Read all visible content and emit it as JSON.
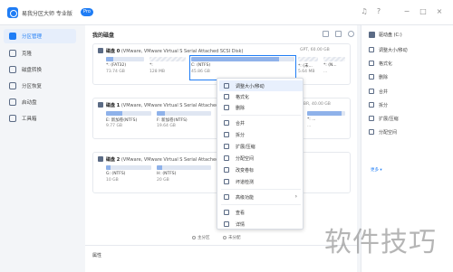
{
  "app": {
    "name": "易我分区大师 专业版",
    "badge": "Pro"
  },
  "titlebar_icons": [
    "bell-icon",
    "help-icon",
    "minimize-icon",
    "maximize-icon",
    "close-icon"
  ],
  "sidebar": {
    "items": [
      {
        "label": "分区管理",
        "icon": "partition-icon",
        "active": true
      },
      {
        "label": "克隆",
        "icon": "clone-icon"
      },
      {
        "label": "磁盘转换",
        "icon": "convert-icon"
      },
      {
        "label": "分区恢复",
        "icon": "recovery-icon"
      },
      {
        "label": "启动盘",
        "icon": "bootdisk-icon"
      },
      {
        "label": "工具箱",
        "icon": "toolbox-icon"
      }
    ]
  },
  "main": {
    "title": "我的磁盘",
    "disks": [
      {
        "name": "磁盘 0",
        "desc": "(VMware, VMware Virtual S Serial Attached SCSI Disk)",
        "extra": "GPT, 60.00 GB",
        "partitions": [
          {
            "name": "*: (FAT32)",
            "size": "73.74 GB",
            "fill": 0.2
          },
          {
            "name": "*:",
            "size": "128 MB",
            "fill": 0,
            "dash": true
          },
          {
            "name": "C: (NTFS)",
            "size": "45.86 GB",
            "fill": 0.85,
            "selected": true
          },
          {
            "name": "*: (未...",
            "size": "5.64 MB",
            "fill": 0,
            "dash": true
          },
          {
            "name": "*: (N...",
            "size": "...",
            "fill": 0.5
          }
        ]
      },
      {
        "name": "磁盘 1",
        "desc": "(VMware, VMware Virtual S Serial Attached SCSI Disk)",
        "extra": "MBR, 40.00 GB",
        "partitions": [
          {
            "name": "E: 新加卷(NTFS)",
            "size": "9.77 GB",
            "fill": 0.35
          },
          {
            "name": "F: 新加卷(NTFS)",
            "size": "19.64 GB",
            "fill": 0.15
          },
          {
            "name": "*: ...",
            "size": "...",
            "fill": 0.9
          }
        ]
      },
      {
        "name": "磁盘 2",
        "desc": "(VMware, VMware Virtual S Serial Attached SCSI Disk)",
        "extra": "",
        "partitions": [
          {
            "name": "G: (NTFS)",
            "size": "10 GB",
            "fill": 0.1
          },
          {
            "name": "H: (NTFS)",
            "size": "20 GB",
            "fill": 0.1
          }
        ]
      }
    ],
    "legend": [
      "主分区",
      "未分配"
    ],
    "properties_label": "属性"
  },
  "context_menu": {
    "items": [
      {
        "label": "调整大小/移动",
        "icon": "resize-icon",
        "highlighted": true
      },
      {
        "label": "格式化",
        "icon": "format-icon"
      },
      {
        "label": "删除",
        "icon": "delete-icon"
      },
      {
        "label": "合并",
        "icon": "merge-icon"
      },
      {
        "label": "拆分",
        "icon": "split-icon"
      },
      {
        "label": "扩展/压缩",
        "icon": "extend-icon"
      },
      {
        "label": "分配空间",
        "icon": "allocate-icon"
      },
      {
        "label": "改变卷标",
        "icon": "label-icon"
      },
      {
        "label": "坏道检测",
        "icon": "surface-test-icon"
      },
      {
        "label": "高级功能",
        "icon": "advanced-icon",
        "submenu": true
      },
      {
        "label": "查看",
        "icon": "view-icon"
      },
      {
        "label": "详情",
        "icon": "details-icon"
      }
    ]
  },
  "right_panel": {
    "header": "驱动盘 (C:)",
    "items": [
      {
        "label": "调整大小/移动",
        "icon": "resize-icon"
      },
      {
        "label": "格式化",
        "icon": "format-icon"
      },
      {
        "label": "删除",
        "icon": "delete-icon"
      },
      {
        "label": "合并",
        "icon": "merge-icon"
      },
      {
        "label": "拆分",
        "icon": "split-icon"
      },
      {
        "label": "扩展/压缩",
        "icon": "extend-icon"
      },
      {
        "label": "分配空间",
        "icon": "allocate-icon"
      }
    ],
    "more": "更多 ▾"
  },
  "watermark": "软件技巧"
}
